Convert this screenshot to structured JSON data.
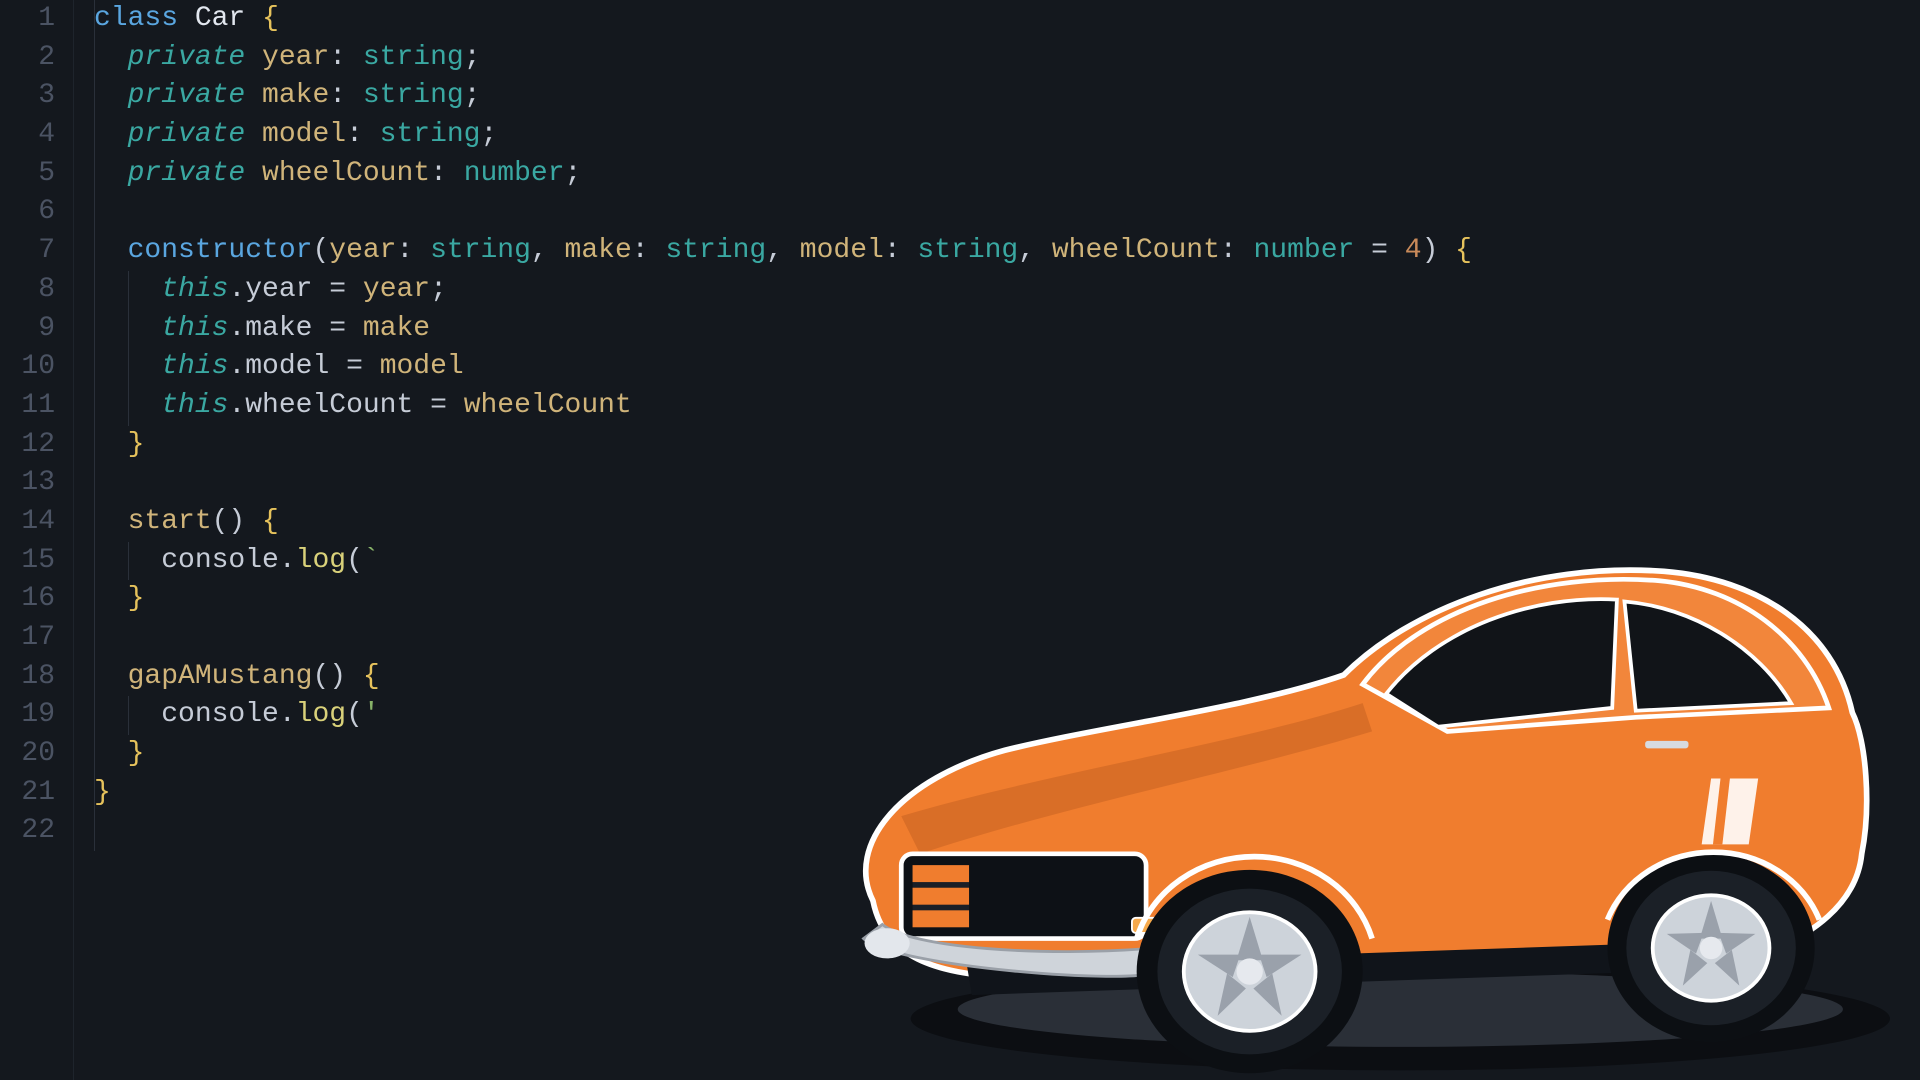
{
  "language": "typescript",
  "illustration": {
    "name": "car-illustration",
    "color": "#f07d2e"
  },
  "gutter": {
    "start": 1,
    "end": 22
  },
  "code": {
    "lines": [
      {
        "n": 1,
        "indent": 0,
        "tokens": [
          [
            "k-storage",
            "class"
          ],
          [
            "sp",
            " "
          ],
          [
            "k-name",
            "Car"
          ],
          [
            "sp",
            " "
          ],
          [
            "k-brace",
            "{"
          ]
        ]
      },
      {
        "n": 2,
        "indent": 1,
        "tokens": [
          [
            "k-modifier",
            "private"
          ],
          [
            "sp",
            " "
          ],
          [
            "k-ident",
            "year"
          ],
          [
            "k-punc",
            ": "
          ],
          [
            "k-type",
            "string"
          ],
          [
            "k-punc",
            ";"
          ]
        ]
      },
      {
        "n": 3,
        "indent": 1,
        "tokens": [
          [
            "k-modifier",
            "private"
          ],
          [
            "sp",
            " "
          ],
          [
            "k-ident",
            "make"
          ],
          [
            "k-punc",
            ": "
          ],
          [
            "k-type",
            "string"
          ],
          [
            "k-punc",
            ";"
          ]
        ]
      },
      {
        "n": 4,
        "indent": 1,
        "tokens": [
          [
            "k-modifier",
            "private"
          ],
          [
            "sp",
            " "
          ],
          [
            "k-ident",
            "model"
          ],
          [
            "k-punc",
            ": "
          ],
          [
            "k-type",
            "string"
          ],
          [
            "k-punc",
            ";"
          ]
        ]
      },
      {
        "n": 5,
        "indent": 1,
        "tokens": [
          [
            "k-modifier",
            "private"
          ],
          [
            "sp",
            " "
          ],
          [
            "k-ident",
            "wheelCount"
          ],
          [
            "k-punc",
            ": "
          ],
          [
            "k-type",
            "number"
          ],
          [
            "k-punc",
            ";"
          ]
        ]
      },
      {
        "n": 6,
        "indent": 0,
        "tokens": []
      },
      {
        "n": 7,
        "indent": 1,
        "tokens": [
          [
            "k-ctor",
            "constructor"
          ],
          [
            "k-punc",
            "("
          ],
          [
            "k-param",
            "year"
          ],
          [
            "k-punc",
            ": "
          ],
          [
            "k-type",
            "string"
          ],
          [
            "k-punc",
            ", "
          ],
          [
            "k-param",
            "make"
          ],
          [
            "k-punc",
            ": "
          ],
          [
            "k-type",
            "string"
          ],
          [
            "k-punc",
            ", "
          ],
          [
            "k-param",
            "model"
          ],
          [
            "k-punc",
            ": "
          ],
          [
            "k-type",
            "string"
          ],
          [
            "k-punc",
            ", "
          ],
          [
            "k-param",
            "wheelCount"
          ],
          [
            "k-punc",
            ": "
          ],
          [
            "k-type",
            "number"
          ],
          [
            "k-punc",
            " = "
          ],
          [
            "k-num",
            "4"
          ],
          [
            "k-punc",
            ") "
          ],
          [
            "k-brace",
            "{"
          ]
        ]
      },
      {
        "n": 8,
        "indent": 2,
        "tokens": [
          [
            "k-this",
            "this"
          ],
          [
            "k-punc",
            "."
          ],
          [
            "k-prop",
            "year"
          ],
          [
            "k-punc",
            " = "
          ],
          [
            "k-ident",
            "year"
          ],
          [
            "k-punc",
            ";"
          ]
        ]
      },
      {
        "n": 9,
        "indent": 2,
        "tokens": [
          [
            "k-this",
            "this"
          ],
          [
            "k-punc",
            "."
          ],
          [
            "k-prop",
            "make"
          ],
          [
            "k-punc",
            " = "
          ],
          [
            "k-ident",
            "make"
          ]
        ]
      },
      {
        "n": 10,
        "indent": 2,
        "tokens": [
          [
            "k-this",
            "this"
          ],
          [
            "k-punc",
            "."
          ],
          [
            "k-prop",
            "model"
          ],
          [
            "k-punc",
            " = "
          ],
          [
            "k-ident",
            "model"
          ]
        ]
      },
      {
        "n": 11,
        "indent": 2,
        "tokens": [
          [
            "k-this",
            "this"
          ],
          [
            "k-punc",
            "."
          ],
          [
            "k-prop",
            "wheelCount"
          ],
          [
            "k-punc",
            " = "
          ],
          [
            "k-ident",
            "wheelCount"
          ]
        ]
      },
      {
        "n": 12,
        "indent": 1,
        "tokens": [
          [
            "k-brace",
            "}"
          ]
        ]
      },
      {
        "n": 13,
        "indent": 0,
        "tokens": []
      },
      {
        "n": 14,
        "indent": 1,
        "tokens": [
          [
            "k-method",
            "start"
          ],
          [
            "k-punc",
            "() "
          ],
          [
            "k-brace",
            "{"
          ]
        ]
      },
      {
        "n": 15,
        "indent": 2,
        "tokens": [
          [
            "k-console",
            "console"
          ],
          [
            "k-punc",
            "."
          ],
          [
            "k-func",
            "log"
          ],
          [
            "k-punc",
            "("
          ],
          [
            "k-str",
            "`"
          ]
        ]
      },
      {
        "n": 16,
        "indent": 1,
        "tokens": [
          [
            "k-brace",
            "}"
          ]
        ]
      },
      {
        "n": 17,
        "indent": 0,
        "tokens": []
      },
      {
        "n": 18,
        "indent": 1,
        "tokens": [
          [
            "k-method",
            "gapAMustang"
          ],
          [
            "k-punc",
            "() "
          ],
          [
            "k-brace",
            "{"
          ]
        ]
      },
      {
        "n": 19,
        "indent": 2,
        "tokens": [
          [
            "k-console",
            "console"
          ],
          [
            "k-punc",
            "."
          ],
          [
            "k-func",
            "log"
          ],
          [
            "k-punc",
            "("
          ],
          [
            "k-str",
            "'"
          ]
        ]
      },
      {
        "n": 20,
        "indent": 1,
        "tokens": [
          [
            "k-brace",
            "}"
          ]
        ]
      },
      {
        "n": 21,
        "indent": 0,
        "tokens": [
          [
            "k-brace",
            "}"
          ]
        ]
      },
      {
        "n": 22,
        "indent": 0,
        "tokens": []
      }
    ]
  }
}
